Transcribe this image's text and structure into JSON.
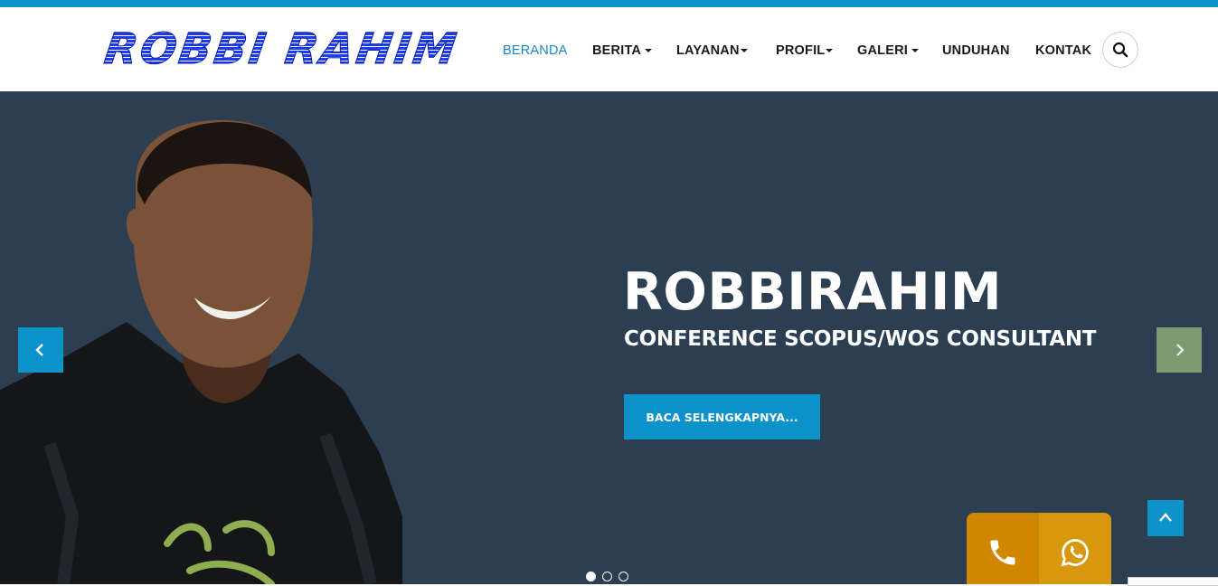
{
  "brand": {
    "logo_text": "ROBBI RAHIM"
  },
  "nav": {
    "items": [
      {
        "label": "BERANDA",
        "active": true,
        "dropdown": false
      },
      {
        "label": "BERITA",
        "active": false,
        "dropdown": true
      },
      {
        "label": "LAYANAN",
        "active": false,
        "dropdown": true
      },
      {
        "label": "PROFIL",
        "active": false,
        "dropdown": true
      },
      {
        "label": "GALERI",
        "active": false,
        "dropdown": true
      },
      {
        "label": "UNDUHAN",
        "active": false,
        "dropdown": false
      },
      {
        "label": "KONTAK",
        "active": false,
        "dropdown": false
      }
    ],
    "search_icon": "search-icon"
  },
  "hero": {
    "title": "ROBBIRAHIM",
    "subtitle": "CONFERENCE SCOPUS/WOS CONSULTANT",
    "button_label": "BACA SELENGKAPNYA...",
    "slides_count": 3,
    "active_slide": 1
  },
  "contact": {
    "call_icon": "phone-icon",
    "whatsapp_icon": "whatsapp-icon"
  },
  "colors": {
    "accent": "#0d93c9",
    "hero_bg": "#2c3e52",
    "contact_orange": "#d18600",
    "logo_blue": "#1339f0"
  }
}
